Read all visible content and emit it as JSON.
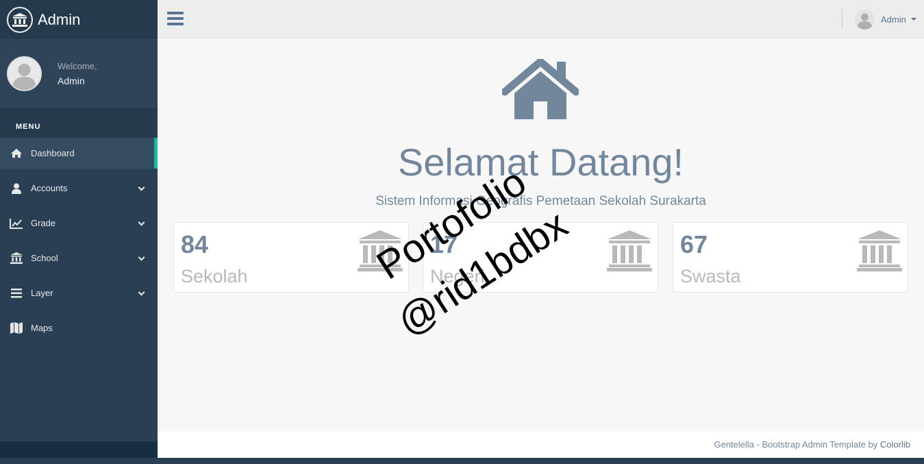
{
  "brand": {
    "title": "Admin",
    "icon": "bank-icon"
  },
  "profile": {
    "welcome": "Welcome,",
    "name": "Admin"
  },
  "menu": {
    "section_title": "MENU",
    "items": [
      {
        "label": "Dashboard",
        "icon": "home-icon",
        "active": true,
        "has_submenu": false
      },
      {
        "label": "Accounts",
        "icon": "user-icon",
        "active": false,
        "has_submenu": true
      },
      {
        "label": "Grade",
        "icon": "line-chart-icon",
        "active": false,
        "has_submenu": true
      },
      {
        "label": "School",
        "icon": "bank-icon",
        "active": false,
        "has_submenu": true
      },
      {
        "label": "Layer",
        "icon": "bars-icon",
        "active": false,
        "has_submenu": true
      },
      {
        "label": "Maps",
        "icon": "map-icon",
        "active": false,
        "has_submenu": false
      }
    ]
  },
  "topnav": {
    "user_name": "Admin"
  },
  "hero": {
    "title": "Selamat Datang!",
    "subtitle": "Sistem Informasi Geografis Pemetaan Sekolah Surakarta"
  },
  "stats": [
    {
      "count": "84",
      "label": "Sekolah",
      "icon": "bank-icon"
    },
    {
      "count": "17",
      "label": "Negeri",
      "icon": "bank-icon"
    },
    {
      "count": "67",
      "label": "Swasta",
      "icon": "bank-icon"
    }
  ],
  "footer": {
    "text": "Gentelella - Bootstrap Admin Template by ",
    "link": "Colorlib"
  },
  "watermark": {
    "line1": "Portofolio",
    "line2": "@rid1bdbx"
  },
  "colors": {
    "sidebar": "#2A3F54",
    "accent": "#1ABB9C",
    "text": "#73879C",
    "muted": "#BAB8B8"
  }
}
